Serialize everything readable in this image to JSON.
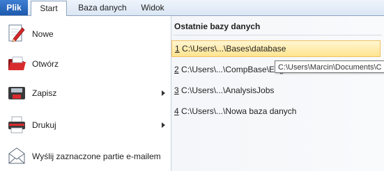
{
  "ribbon": {
    "tabs": [
      {
        "label": "Plik"
      },
      {
        "label": "Start"
      },
      {
        "label": "Baza danych"
      },
      {
        "label": "Widok"
      }
    ]
  },
  "backstage": {
    "commands": [
      {
        "label": "Nowe",
        "icon": "new-document-pencil-icon"
      },
      {
        "label": "Otwórz",
        "icon": "open-folder-icon"
      },
      {
        "label": "Zapisz",
        "icon": "save-disk-icon",
        "has_submenu": true
      },
      {
        "label": "Drukuj",
        "icon": "printer-icon",
        "has_submenu": true
      },
      {
        "label": "Wyślij zaznaczone partie e-mailem",
        "icon": "email-envelope-icon"
      }
    ]
  },
  "recent": {
    "heading": "Ostatnie bazy danych",
    "items": [
      {
        "number": "1",
        "path": " C:\\Users\\...\\Bases\\database"
      },
      {
        "number": "2",
        "path": " C:\\Users\\...\\CompBase\\Eng"
      },
      {
        "number": "3",
        "path": " C:\\Users\\...\\AnalysisJobs"
      },
      {
        "number": "4",
        "path": " C:\\Users\\...\\Nowa baza danych"
      }
    ],
    "tooltip": "C:\\Users\\Marcin\\Documents\\C"
  },
  "colors": {
    "file_tab": "#2b66be",
    "selection": "#ffe48f",
    "pane_border": "#c7d1de"
  }
}
